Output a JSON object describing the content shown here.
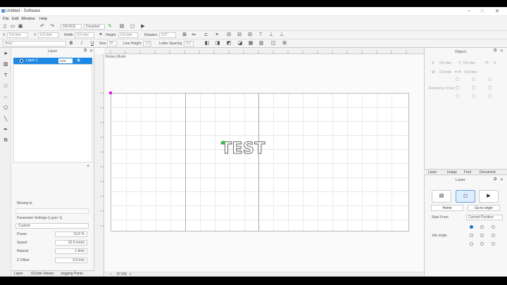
{
  "window": {
    "title": "Untitled - Software"
  },
  "menu": [
    "File",
    "Edit",
    "Window",
    "Help"
  ],
  "toolbar": {
    "device": "DEVICE",
    "status": "Disabled"
  },
  "propbar": {
    "x_label": "X",
    "y_label": "Y",
    "x_val": "0.0 mm",
    "y_val": "0.0 mm",
    "width_label": "Width",
    "width_val": "0.0 mm",
    "height_label": "Height",
    "height_val": "0.0 mm",
    "rotation_label": "Rotation",
    "rotation_val": "0.0°"
  },
  "propbar2": {
    "font": "Arial",
    "bold": "B",
    "italic": "I",
    "underline": "U",
    "size_label": "Size",
    "size_val": "20",
    "lineheight_label": "Line Height",
    "lineheight_val": "1.0",
    "spacing_label": "Letter Spacing",
    "spacing_val": "0.0"
  },
  "layers": {
    "title": "Layer",
    "items": [
      {
        "name": "Layer 1",
        "mode": "Line"
      }
    ],
    "add": "+"
  },
  "params": {
    "heading": "Parameter Settings (Layer 1)",
    "preset": "Custom",
    "moving_label": "Moving to",
    "power_label": "Power",
    "power_val": "10.0 %",
    "speed_label": "Speed",
    "speed_val": "10.0 mm/s",
    "repeat_label": "Repeat",
    "repeat_val": "1 time",
    "zoffset_label": "Z Offset",
    "zoffset_val": "0.0 mm"
  },
  "bottom_tabs": [
    "Layer",
    "GCode Viewer",
    "Jogging Panel"
  ],
  "canvas": {
    "rotary_label": "Rotary Mode",
    "text": "TEST",
    "zoom": "87.8%"
  },
  "object_panel": {
    "title": "Object",
    "x": "X",
    "y": "Y",
    "w": "W",
    "h": "H",
    "x_val": "0.0 mm",
    "y_val": "0.0 mm",
    "w_val": "0.0 mm",
    "h_val": "0.0 mm",
    "reference": "Reference Point"
  },
  "right_tabs": [
    "Laser",
    "Image",
    "Font",
    "Document"
  ],
  "laser_panel": {
    "title": "Laser",
    "home": "Home",
    "go_origin": "Go to origin",
    "start_from_label": "Start From",
    "start_from_val": "Current Position",
    "job_origin_label": "Job origin"
  }
}
